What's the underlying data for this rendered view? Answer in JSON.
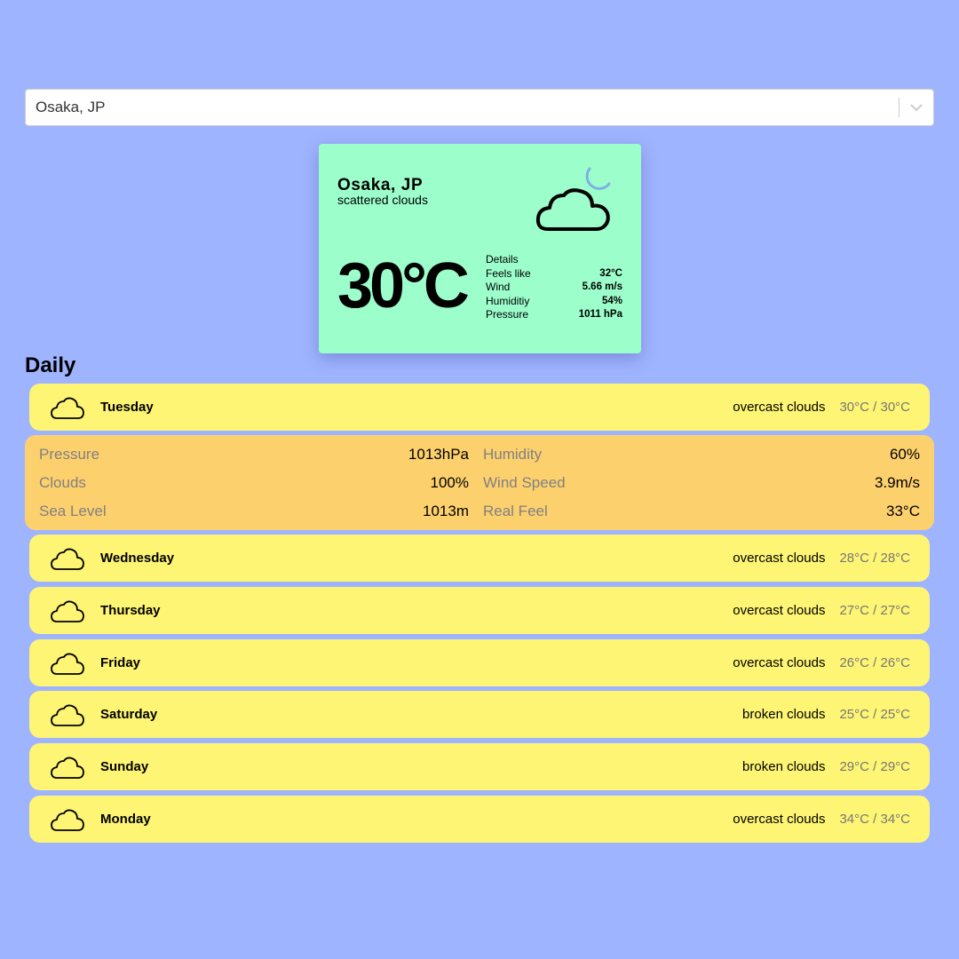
{
  "search": {
    "value": "Osaka, JP"
  },
  "current": {
    "city": "Osaka, JP",
    "description": "scattered clouds",
    "temperature": "30°C",
    "icon": "cloud-moon-icon",
    "details_title": "Details",
    "details": [
      {
        "label": "Feels like",
        "value": "32°C"
      },
      {
        "label": "Wind",
        "value": "5.66 m/s"
      },
      {
        "label": "Humiditiy",
        "value": "54%"
      },
      {
        "label": "Pressure",
        "value": "1011 hPa"
      }
    ]
  },
  "daily": {
    "title": "Daily",
    "days": [
      {
        "name": "Tuesday",
        "condition": "overcast clouds",
        "range": "30°C / 30°C",
        "icon": "cloud-icon"
      },
      {
        "name": "Wednesday",
        "condition": "overcast clouds",
        "range": "28°C / 28°C",
        "icon": "cloud-icon"
      },
      {
        "name": "Thursday",
        "condition": "overcast clouds",
        "range": "27°C / 27°C",
        "icon": "cloud-icon"
      },
      {
        "name": "Friday",
        "condition": "overcast clouds",
        "range": "26°C / 26°C",
        "icon": "cloud-icon"
      },
      {
        "name": "Saturday",
        "condition": "broken clouds",
        "range": "25°C / 25°C",
        "icon": "cloud-icon"
      },
      {
        "name": "Sunday",
        "condition": "broken clouds",
        "range": "29°C / 29°C",
        "icon": "cloud-icon"
      },
      {
        "name": "Monday",
        "condition": "overcast clouds",
        "range": "34°C / 34°C",
        "icon": "cloud-icon"
      }
    ],
    "expanded": {
      "left": [
        {
          "label": "Pressure",
          "value": "1013hPa"
        },
        {
          "label": "Clouds",
          "value": "100%"
        },
        {
          "label": "Sea Level",
          "value": "1013m"
        }
      ],
      "right": [
        {
          "label": "Humidity",
          "value": "60%"
        },
        {
          "label": "Wind Speed",
          "value": "3.9m/s"
        },
        {
          "label": "Real Feel",
          "value": "33°C"
        }
      ]
    }
  },
  "colors": {
    "background": "#9fb4ff",
    "card": "#9bfecb",
    "day_row": "#fef574",
    "expanded": "#fdd06e",
    "moon": "#7fb0e6"
  }
}
